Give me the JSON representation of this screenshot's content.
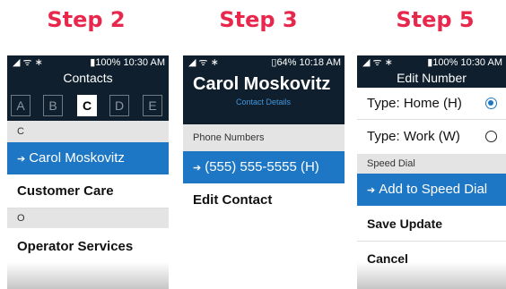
{
  "steps": [
    "Step 2",
    "Step 3",
    "Step 5"
  ],
  "screen1": {
    "status_left": "◢ ᯤ ∗",
    "status_right": "▮100% 10:30 AM",
    "title": "Contacts",
    "tabs": [
      "A",
      "B",
      "C",
      "D",
      "E"
    ],
    "active_tab": "C",
    "section_c": "C",
    "selected_contact": "Carol Moskovitz",
    "contact2": "Customer Care",
    "section_o": "O",
    "contact3": "Operator Services"
  },
  "screen2": {
    "status_left": "◢ ᯤ ∗",
    "status_right": "▯64% 10:18 AM",
    "name": "Carol Moskovitz",
    "subtitle": "Contact Details",
    "section": "Phone Numbers",
    "selected_phone": "(555) 555-5555 (H)",
    "edit": "Edit Contact"
  },
  "screen3": {
    "status_left": "◢ ᯤ ∗",
    "status_right": "▮100% 10:30 AM",
    "title": "Edit Number",
    "type_home": "Type: Home (H)",
    "type_work": "Type: Work (W)",
    "section": "Speed Dial",
    "selected": "Add to Speed Dial",
    "save": "Save Update",
    "cancel": "Cancel"
  },
  "arrow_glyph": "➔",
  "colors": {
    "accent_red": "#e8274d",
    "header_dark": "#0f1f2d",
    "highlight_blue": "#1d77c4"
  }
}
